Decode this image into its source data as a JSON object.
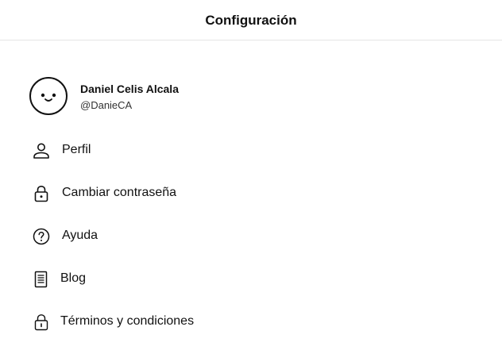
{
  "header": {
    "title": "Configuración"
  },
  "profile": {
    "name": "Daniel Celis Alcala",
    "handle": "@DanieCA",
    "avatar_icon": "smiley-face-icon"
  },
  "menu": {
    "items": [
      {
        "label": "Perfil",
        "icon": "user-icon"
      },
      {
        "label": "Cambiar contraseña",
        "icon": "lock-icon"
      },
      {
        "label": "Ayuda",
        "icon": "help-circle-icon"
      },
      {
        "label": "Blog",
        "icon": "document-icon"
      },
      {
        "label": "Términos y condiciones",
        "icon": "lock-icon"
      }
    ]
  },
  "colors": {
    "text": "#111111",
    "divider": "#e5e5e5",
    "background": "#ffffff"
  }
}
